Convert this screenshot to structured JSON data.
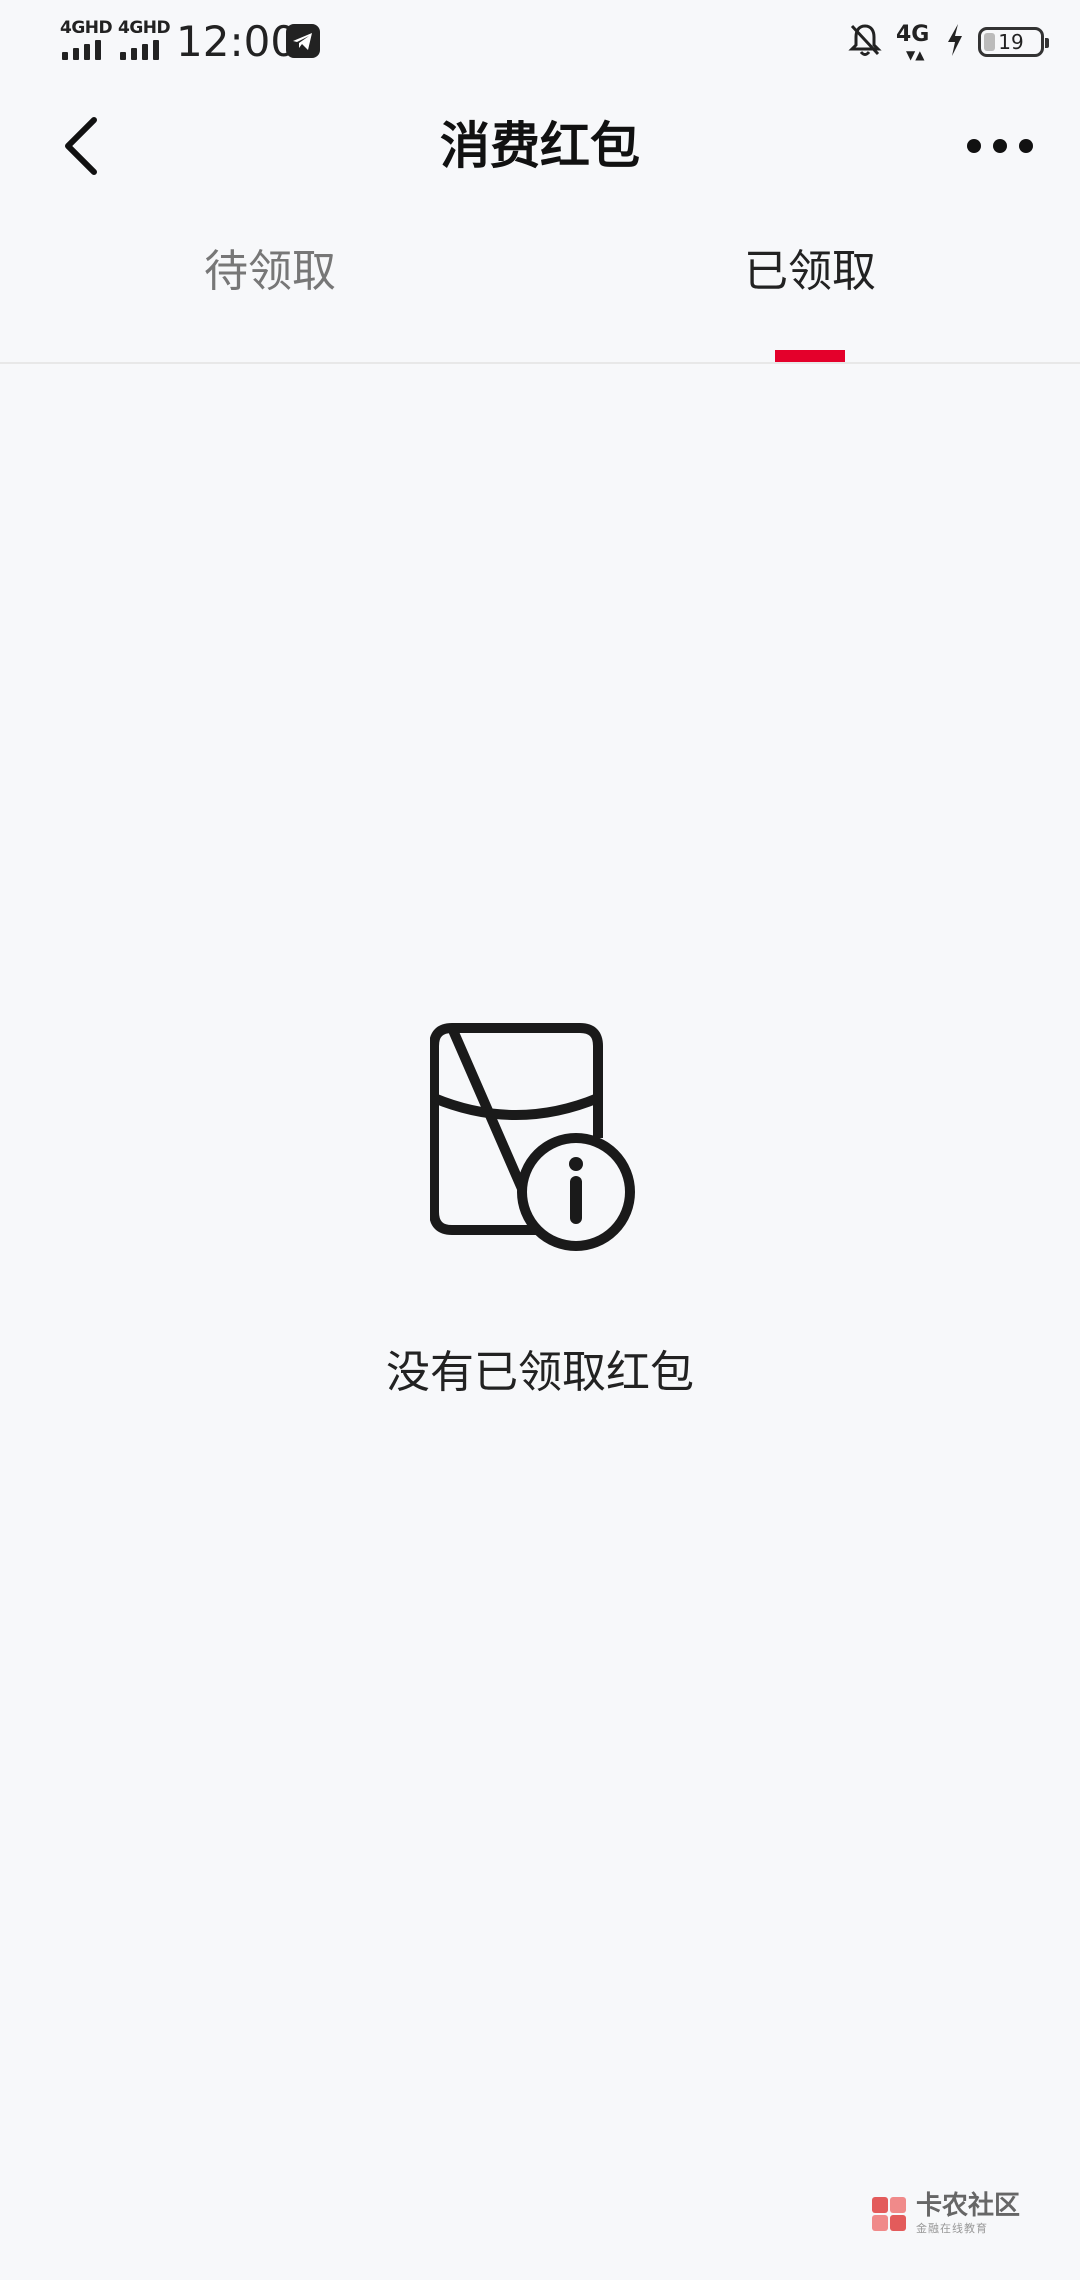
{
  "status_bar": {
    "net1": "4GHD",
    "net2": "4GHD",
    "time": "12:00",
    "net3": "4G",
    "battery_level": "19"
  },
  "nav": {
    "title": "消费红包"
  },
  "tabs": [
    {
      "label": "待领取",
      "active": false
    },
    {
      "label": "已领取",
      "active": true
    }
  ],
  "empty_state": {
    "message": "没有已领取红包"
  },
  "watermark": {
    "text": "卡农社区",
    "subtext": "金融在线教育"
  },
  "colors": {
    "accent": "#e4002b",
    "background": "#f7f8fa"
  }
}
